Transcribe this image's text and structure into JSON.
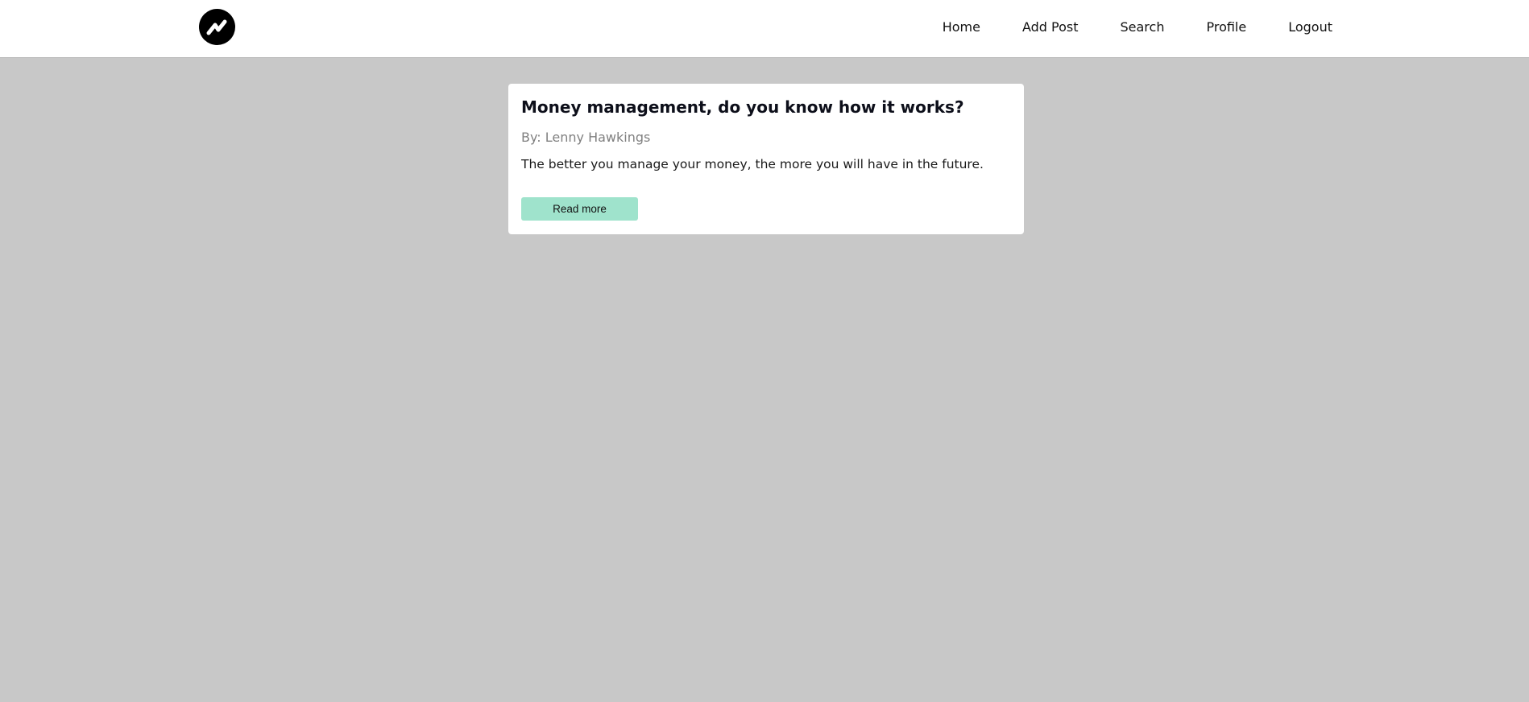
{
  "nav": {
    "logo_icon": "zigzag-bolt-logo",
    "links": [
      "Home",
      "Add Post",
      "Search",
      "Profile",
      "Logout"
    ]
  },
  "post": {
    "title": "Money management, do you know how it works?",
    "author": "By: Lenny Hawkings",
    "excerpt": "The better you manage your money, the more you will have in the future.",
    "read_more_label": "Read more"
  },
  "colors": {
    "background": "#c8c8c8",
    "card": "#ffffff",
    "accent_button": "#9fe3cc",
    "author_text": "#808080"
  }
}
